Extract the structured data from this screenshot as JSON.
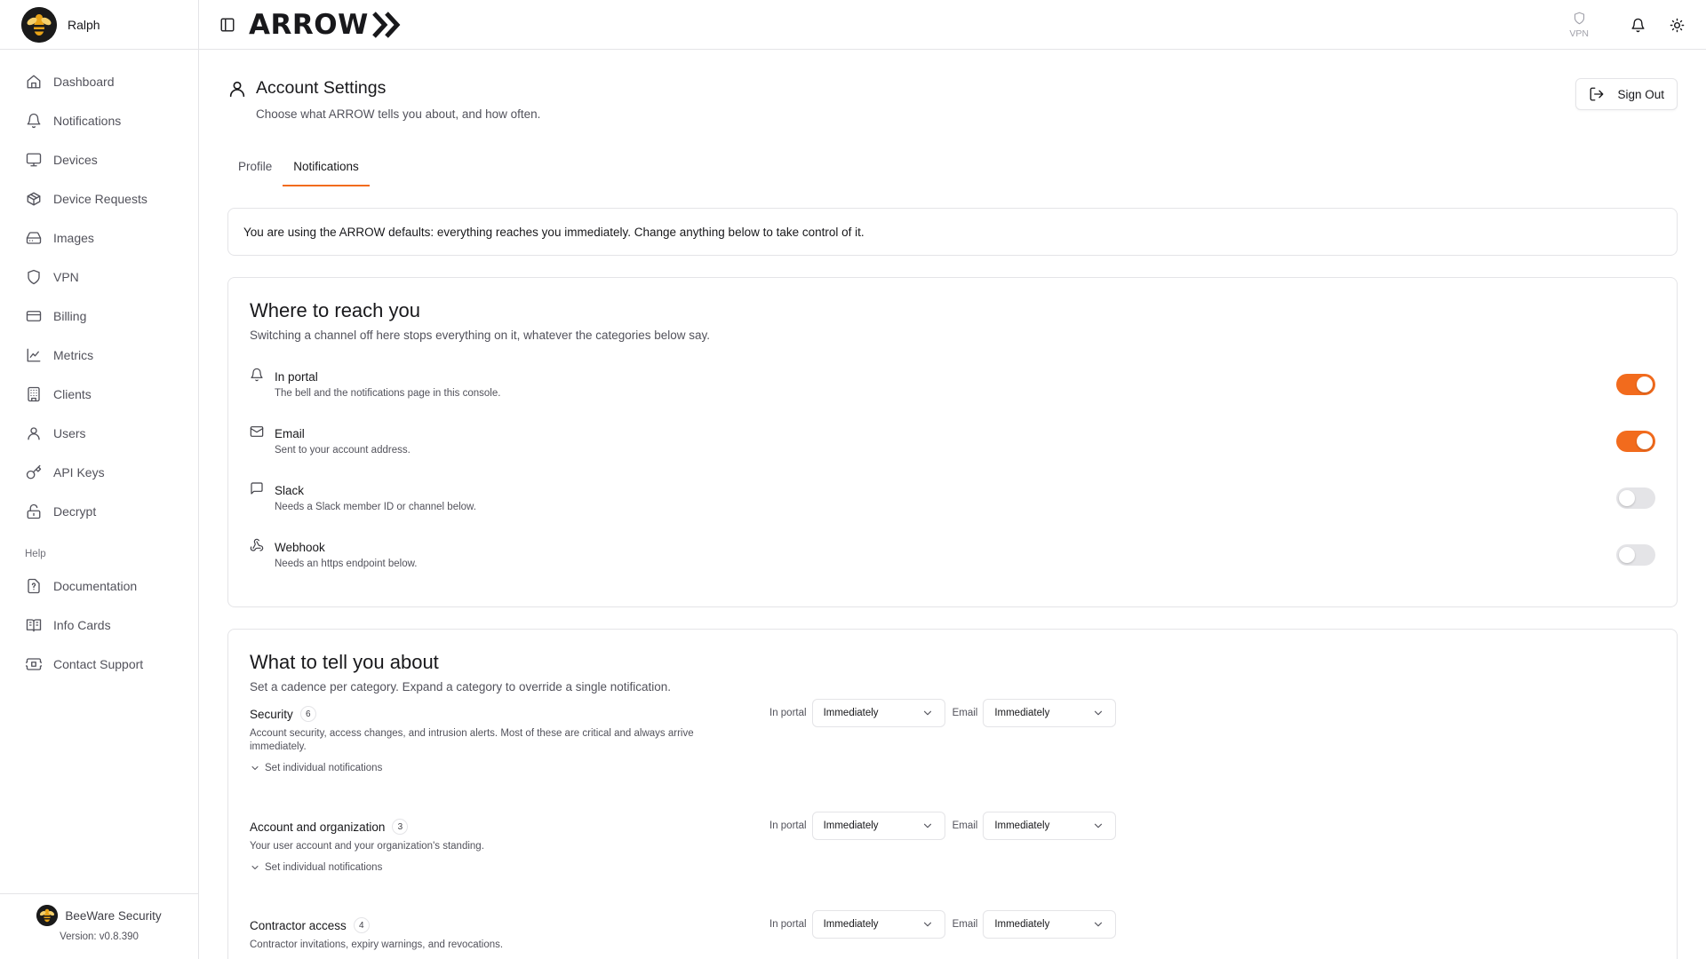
{
  "user": {
    "name": "Ralph"
  },
  "brand": {
    "name": "ARROW"
  },
  "colors": {
    "accent": "#f26b1d",
    "border": "#e4e4e7",
    "muted": "#52525b"
  },
  "sidebar": {
    "items": [
      {
        "label": "Dashboard",
        "icon": "home-icon"
      },
      {
        "label": "Notifications",
        "icon": "bell-icon"
      },
      {
        "label": "Devices",
        "icon": "monitor-icon"
      },
      {
        "label": "Device Requests",
        "icon": "package-icon"
      },
      {
        "label": "Images",
        "icon": "hard-drive-icon"
      },
      {
        "label": "VPN",
        "icon": "shield-icon"
      },
      {
        "label": "Billing",
        "icon": "credit-card-icon"
      },
      {
        "label": "Metrics",
        "icon": "line-chart-icon"
      },
      {
        "label": "Clients",
        "icon": "building-icon"
      },
      {
        "label": "Users",
        "icon": "user-icon"
      },
      {
        "label": "API Keys",
        "icon": "key-icon"
      },
      {
        "label": "Decrypt",
        "icon": "unlock-icon"
      }
    ],
    "help_heading": "Help",
    "help_items": [
      {
        "label": "Documentation",
        "icon": "help-file-icon"
      },
      {
        "label": "Info Cards",
        "icon": "book-icon"
      },
      {
        "label": "Contact Support",
        "icon": "ticket-icon"
      }
    ],
    "footer": {
      "org_name": "BeeWare Security",
      "version": "Version: v0.8.390"
    }
  },
  "topbar": {
    "vpn_label": "VPN"
  },
  "page": {
    "title": "Account Settings",
    "subtitle": "Choose what ARROW tells you about, and how often.",
    "sign_out": "Sign Out",
    "tabs": [
      {
        "label": "Profile",
        "active": false
      },
      {
        "label": "Notifications",
        "active": true
      }
    ],
    "banner": "You are using the ARROW defaults: everything reaches you immediately. Change anything below to take control of it."
  },
  "channels_card": {
    "title": "Where to reach you",
    "subtitle": "Switching a channel off here stops everything on it, whatever the categories below say.",
    "channels": [
      {
        "name": "In portal",
        "desc": "The bell and the notifications page in this console.",
        "icon": "bell-icon",
        "enabled": true
      },
      {
        "name": "Email",
        "desc": "Sent to your account address.",
        "icon": "mail-icon",
        "enabled": true
      },
      {
        "name": "Slack",
        "desc": "Needs a Slack member ID or channel below.",
        "icon": "message-icon",
        "enabled": false
      },
      {
        "name": "Webhook",
        "desc": "Needs an https endpoint below.",
        "icon": "webhook-icon",
        "enabled": false
      }
    ]
  },
  "categories_card": {
    "title": "What to tell you about",
    "subtitle": "Set a cadence per category. Expand a category to override a single notification.",
    "portal_label": "In portal",
    "email_label": "Email",
    "expand_label": "Set individual notifications",
    "categories": [
      {
        "name": "Security",
        "count": "6",
        "desc": "Account security, access changes, and intrusion alerts. Most of these are critical and always arrive immediately.",
        "portal": "Immediately",
        "email": "Immediately"
      },
      {
        "name": "Account and organization",
        "count": "3",
        "desc": "Your user account and your organization's standing.",
        "portal": "Immediately",
        "email": "Immediately"
      },
      {
        "name": "Contractor access",
        "count": "4",
        "desc": "Contractor invitations, expiry warnings, and revocations.",
        "portal": "Immediately",
        "email": "Immediately"
      }
    ]
  }
}
